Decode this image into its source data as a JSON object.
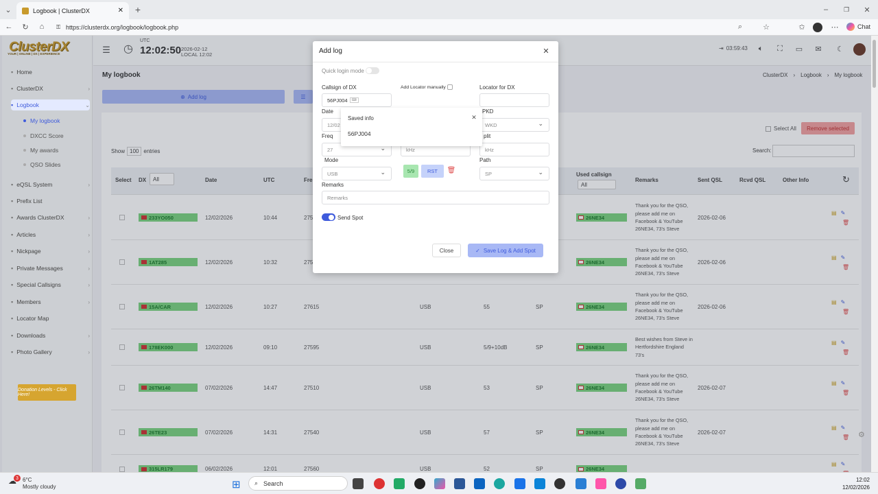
{
  "browser": {
    "tab_title": "Logbook | ClusterDX",
    "url": "https://clusterdx.org/logbook/logbook.php",
    "chat_label": "Chat"
  },
  "header": {
    "logo": "ClusterDX",
    "logo_tag": "YOUR | ONLINE | DX | EXPERIENCE",
    "utc_label": "UTC",
    "utc_time": "12:02:50",
    "utc_date": "2026-02-12",
    "local_label": "LOCAL 12:02",
    "session_time": "03:59:43"
  },
  "sidebar": {
    "items": [
      {
        "label": "Home",
        "icon": "home-icon"
      },
      {
        "label": "ClusterDX",
        "icon": "server-icon"
      },
      {
        "label": "Logbook",
        "icon": "book-icon"
      },
      {
        "label": "eQSL System",
        "icon": "cards-icon"
      },
      {
        "label": "Prefix List",
        "icon": "list-icon"
      },
      {
        "label": "Awards ClusterDX",
        "icon": "award-icon"
      },
      {
        "label": "Articles",
        "icon": "article-icon"
      },
      {
        "label": "Nickpage",
        "icon": "tag-icon"
      },
      {
        "label": "Private Messages",
        "icon": "mail-icon"
      },
      {
        "label": "Special Callsigns",
        "icon": "people-icon"
      },
      {
        "label": "Members",
        "icon": "members-icon"
      },
      {
        "label": "Locator Map",
        "icon": "map-icon"
      },
      {
        "label": "Downloads",
        "icon": "download-icon"
      },
      {
        "label": "Photo Gallery",
        "icon": "photo-icon"
      }
    ],
    "logbook_sub": [
      "My logbook",
      "DXCC Score",
      "My awards",
      "QSO Slides"
    ],
    "donate": "Donation Levels - Click Here!"
  },
  "page": {
    "title": "My logbook",
    "breadcrumb": [
      "ClusterDX",
      "Logbook",
      "My logbook"
    ],
    "add_log": "Add log",
    "select_all": "Select All",
    "remove_selected": "Remove selected",
    "show": "Show",
    "entries_count": "100",
    "entries": "entries",
    "search_label": "Search:"
  },
  "table": {
    "headers": [
      "Select",
      "DX",
      "All",
      "Date",
      "UTC",
      "Fre",
      "Used callsign",
      "All",
      "Remarks",
      "Sent QSL",
      "Rcvd QSL",
      "Other Info"
    ],
    "rows": [
      {
        "dx": "233YO050",
        "date": "12/02/2026",
        "utc": "10:44",
        "freq": "275",
        "mode": "",
        "rst": "",
        "path": "",
        "used": "26NE34",
        "remarks": "Thank you for the QSO, please add me on Facebook & YouTube 26NE34, 73's Steve",
        "sent": "2026-02-06"
      },
      {
        "dx": "1AT285",
        "date": "12/02/2026",
        "utc": "10:32",
        "freq": "275",
        "mode": "",
        "rst": "",
        "path": "",
        "used": "26NE34",
        "remarks": "Thank you for the QSO, please add me on Facebook & YouTube 26NE34, 73's Steve",
        "sent": "2026-02-06"
      },
      {
        "dx": "15A/CAR",
        "date": "12/02/2026",
        "utc": "10:27",
        "freq": "27615",
        "mode": "USB",
        "rst": "55",
        "path": "SP",
        "used": "26NE34",
        "remarks": "Thank you for the QSO, please add me on Facebook & YouTube 26NE34, 73's Steve",
        "sent": "2026-02-06"
      },
      {
        "dx": "178EK000",
        "date": "12/02/2026",
        "utc": "09:10",
        "freq": "27595",
        "mode": "USB",
        "rst": "5/9+10dB",
        "path": "SP",
        "used": "26NE34",
        "remarks": "Best wishes from Steve in Hertfordshire England 73's",
        "sent": ""
      },
      {
        "dx": "26TM140",
        "date": "07/02/2026",
        "utc": "14:47",
        "freq": "27510",
        "mode": "USB",
        "rst": "53",
        "path": "SP",
        "used": "26NE34",
        "remarks": "Thank you for the QSO, please add me on Facebook & YouTube 26NE34, 73's Steve",
        "sent": "2026-02-07"
      },
      {
        "dx": "26TE23",
        "date": "07/02/2026",
        "utc": "14:31",
        "freq": "27540",
        "mode": "USB",
        "rst": "57",
        "path": "SP",
        "used": "26NE34",
        "remarks": "Thank you for the QSO, please add me on Facebook & YouTube 26NE34, 73's Steve",
        "sent": "2026-02-07"
      },
      {
        "dx": "315LR179",
        "date": "06/02/2026",
        "utc": "12:01",
        "freq": "27560",
        "mode": "USB",
        "rst": "52",
        "path": "SP",
        "used": "26NE34",
        "remarks": "",
        "sent": ""
      }
    ]
  },
  "modal": {
    "title": "Add log",
    "quick_login": "Quick login mode",
    "callsign_label": "Callsign of DX",
    "callsign_value": "56PJ004",
    "add_locator": "Add Locator manually",
    "locator_label": "Locator for DX",
    "date_label": "Date",
    "date_value": "12/02",
    "pkd_label": "PKD",
    "wkd_value": "WKD",
    "freq_label": "Freq",
    "freq_value": "27",
    "khz_placeholder": "kHz",
    "split_label": "plit",
    "split_placeholder": "kHz",
    "mode_label": "Mode",
    "mode_value": "USB",
    "rst_sent": "5/9",
    "rst_btn": "RST",
    "path_label": "Path",
    "path_value": "SP",
    "remarks_label": "Remarks",
    "remarks_placeholder": "Remarks",
    "send_spot": "Send Spot",
    "close": "Close",
    "save": "Save Log & Add Spot",
    "saved_info_title": "Saved info",
    "saved_info_value": "56PJ004"
  },
  "taskbar": {
    "temp": "6°C",
    "weather": "Mostly cloudy",
    "search": "Search",
    "time": "12:02",
    "date": "12/02/2026",
    "badge": "3"
  },
  "colors": {
    "accent": "#4f6ff0",
    "green": "#7ad37f",
    "danger": "#e05050",
    "gold": "#d6a530"
  }
}
